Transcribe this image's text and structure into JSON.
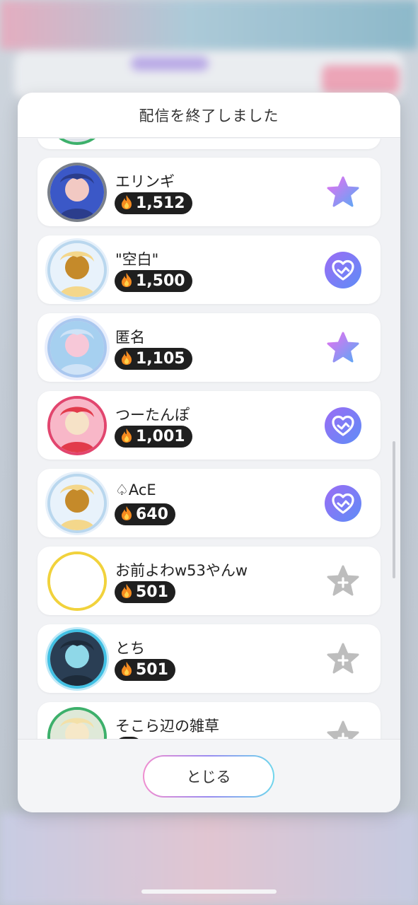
{
  "modal": {
    "title": "配信を終了しました",
    "close_label": "とじる"
  },
  "listeners": [
    {
      "name": "エリンギ",
      "score": "1,512",
      "action_icon": "star-icon",
      "frame": "plain"
    },
    {
      "name": "\"空白\"",
      "score": "1,500",
      "action_icon": "handshake-heart-icon",
      "frame": "wing"
    },
    {
      "name": "匿名",
      "score": "1,105",
      "action_icon": "star-icon",
      "frame": "ice"
    },
    {
      "name": "つーたんぽ",
      "score": "1,001",
      "action_icon": "handshake-heart-icon",
      "frame": "pink"
    },
    {
      "name": "♤AcE",
      "score": "640",
      "action_icon": "handshake-heart-icon",
      "frame": "wing"
    },
    {
      "name": "お前よわw53やんw",
      "score": "501",
      "action_icon": "add-star-icon",
      "frame": "yellow"
    },
    {
      "name": "とち",
      "score": "501",
      "action_icon": "add-star-icon",
      "frame": "cyan"
    },
    {
      "name": "そこら辺の雑草",
      "score": "",
      "action_icon": "add-star-icon",
      "frame": "green"
    }
  ],
  "colors": {
    "star_gradient_start": "#e86ff0",
    "star_gradient_end": "#5aa9f5",
    "handshake_start": "#9b6cf5",
    "handshake_end": "#5e8df6",
    "add_star": "#bdbdbd",
    "score_pill": "#1f1f1f",
    "flame": "#f58a1f"
  }
}
